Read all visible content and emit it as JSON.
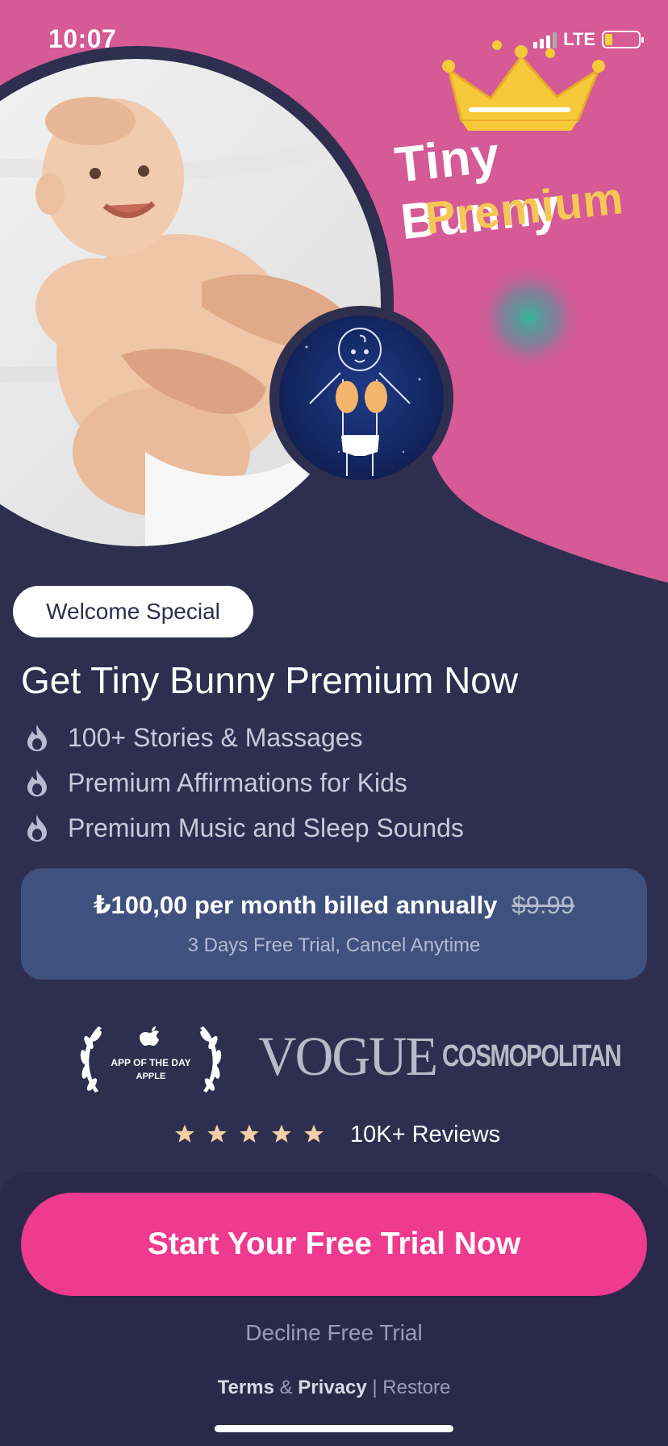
{
  "colors": {
    "hero_pink": "#d55a96",
    "navy": "#2e2e4f",
    "price_box": "#3f527f",
    "cta_pink": "#ee3a8f",
    "crown_yellow": "#f6c93a",
    "star": "#f4cfa6"
  },
  "status_bar": {
    "time": "10:07",
    "network": "LTE",
    "icons": [
      "signal-icon",
      "battery-icon"
    ]
  },
  "hero": {
    "title_line1": "Tiny Bunny",
    "title_line2": "Premium",
    "icons": [
      "crown-icon",
      "baby-massage-photo",
      "baby-outline-icon"
    ]
  },
  "offer": {
    "badge": "Welcome Special",
    "headline": "Get Tiny Bunny Premium Now",
    "features": [
      {
        "icon": "flame-icon",
        "label": "100+ Stories & Massages"
      },
      {
        "icon": "flame-icon",
        "label": "Premium Affirmations for Kids"
      },
      {
        "icon": "flame-icon",
        "label": "Premium Music and Sleep Sounds"
      }
    ]
  },
  "pricing": {
    "main": "₺100,00 per month billed annually",
    "old_price": "$9.99",
    "subtitle": "3 Days Free Trial, Cancel Anytime"
  },
  "press": {
    "award_line1": "APP OF THE DAY",
    "award_line2": "APPLE",
    "vogue": "VOGUE",
    "cosmopolitan": "COSMOPOLITAN"
  },
  "rating": {
    "stars": 5,
    "reviews": "10K+ Reviews"
  },
  "actions": {
    "cta": "Start Your Free Trial Now",
    "decline": "Decline Free Trial",
    "terms": "Terms",
    "amp": "&",
    "privacy": "Privacy",
    "separator": "|",
    "restore": "Restore"
  }
}
